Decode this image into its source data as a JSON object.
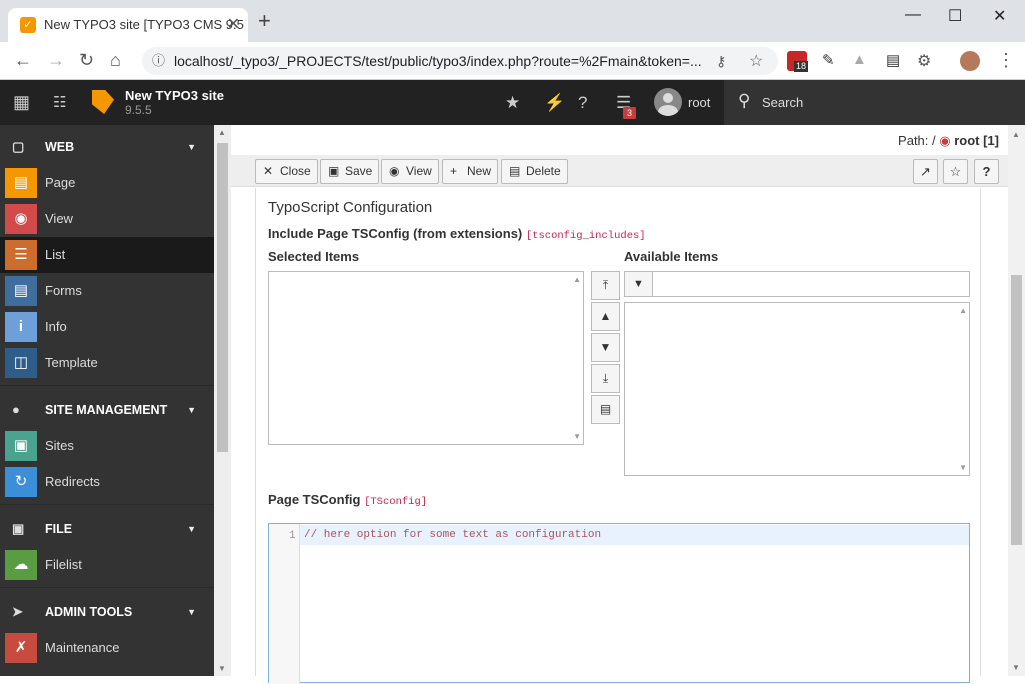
{
  "browser": {
    "tab_title": "New TYPO3 site [TYPO3 CMS 9.5",
    "url": "localhost/_typo3/_PROJECTS/test/public/typo3/index.php?route=%2Fmain&token=...",
    "ext_badge": "18"
  },
  "topbar": {
    "site_name": "New TYPO3 site",
    "version": "9.5.5",
    "notif_count": "3",
    "user": "root",
    "search_label": "Search"
  },
  "sidebar": {
    "groups": {
      "web": "WEB",
      "site": "SITE MANAGEMENT",
      "file": "FILE",
      "admin": "ADMIN TOOLS"
    },
    "modules": {
      "page": "Page",
      "view": "View",
      "list": "List",
      "forms": "Forms",
      "info": "Info",
      "template": "Template",
      "sites": "Sites",
      "redirects": "Redirects",
      "filelist": "Filelist",
      "maintenance": "Maintenance"
    },
    "colors": {
      "page": "#f49700",
      "view": "#d34a4a",
      "list": "#cc6d2e",
      "forms": "#3f6d9e",
      "info": "#6f9fd8",
      "template": "#2f5d8a",
      "sites": "#4aa38f",
      "redirects": "#3b8fd9",
      "filelist": "#5a9c42",
      "maintenance": "#c84b3f"
    }
  },
  "content": {
    "path_label": "Path: /",
    "path_value": "root [1]",
    "buttons": {
      "close": "Close",
      "save": "Save",
      "view": "View",
      "new": "New",
      "delete": "Delete"
    },
    "section_title": "TypoScript Configuration",
    "include_label": "Include Page TSConfig (from extensions)",
    "include_field": "[tsconfig_includes]",
    "selected_items": "Selected Items",
    "available_items": "Available Items",
    "tsconfig_label": "Page TSConfig",
    "tsconfig_field": "[TSconfig]",
    "line_number": "1",
    "code_line": "// here option for some text as configuration"
  }
}
